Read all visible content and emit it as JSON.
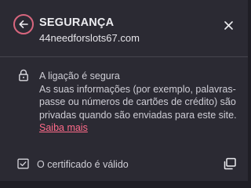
{
  "header": {
    "back_icon": "arrow-left-icon",
    "title": "SEGURANÇA",
    "host": "44needforslots67.com",
    "close_icon": "close-icon"
  },
  "connection": {
    "icon": "lock-icon",
    "heading": "A ligação é segura",
    "description": "As suas informações (por exemplo, palavras-passe ou números de cartões de crédito) são privadas quando são enviadas para este site.",
    "learn_more": "Saiba mais"
  },
  "certificate": {
    "icon": "certificate-icon",
    "label": "O certificado é válido",
    "open_icon": "open-in-window-icon"
  },
  "colors": {
    "background": "#2b2a33",
    "accent": "#ff6b8a",
    "back_ring": "#d8667e",
    "text": "#cfced6"
  }
}
